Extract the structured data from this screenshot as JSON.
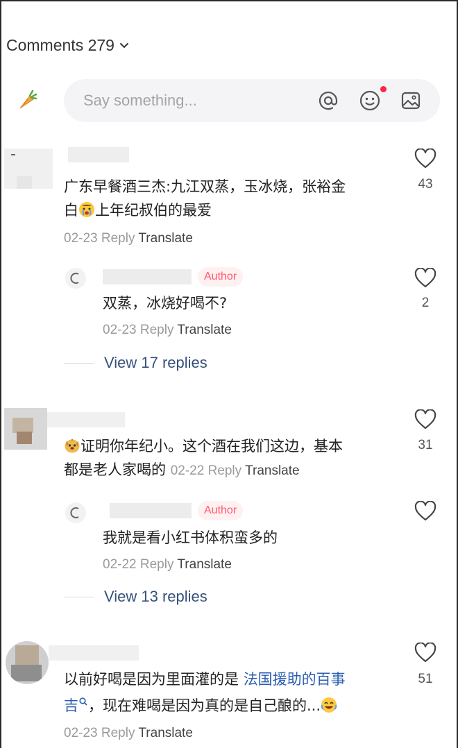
{
  "header": {
    "title": "Comments 279"
  },
  "compose": {
    "placeholder": "Say something..."
  },
  "comments": [
    {
      "text_line1": "广东早餐酒三杰:九江双蒸，玉冰烧，张裕金",
      "text_line2a": "白",
      "text_line2b": "上年纪叔伯的最爱",
      "date": "02-23",
      "reply": "Reply",
      "translate": "Translate",
      "likes": "43",
      "replies": [
        {
          "badge": "Author",
          "text": "双蒸，冰烧好喝不?",
          "date": "02-23",
          "reply": "Reply",
          "translate": "Translate",
          "likes": "2"
        }
      ],
      "view_more": "View 17 replies"
    },
    {
      "text_line1": "证明你年纪小。这个酒在我们这边，基本",
      "text_line2": "都是老人家喝的",
      "date": "02-22",
      "reply": "Reply",
      "translate": "Translate",
      "likes": "31",
      "replies": [
        {
          "badge": "Author",
          "text": "我就是看小红书体积蛮多的",
          "date": "02-22",
          "reply": "Reply",
          "translate": "Translate",
          "likes": ""
        }
      ],
      "view_more": "View 13 replies"
    },
    {
      "text_line1a": "以前好喝是因为里面灌的是 ",
      "text_line1_link": "法国援助的百事",
      "text_line2_link": "吉",
      "text_line2b": "，现在难喝是因为真的是自己酿的...",
      "date": "02-23",
      "reply": "Reply",
      "translate": "Translate",
      "likes": "51"
    }
  ],
  "colors": {
    "accent": "#ff2442",
    "author_badge_bg": "#fff0f2",
    "author_badge_text": "#ff5a6e",
    "link": "#2a5db0",
    "muted": "#9a9a9a"
  },
  "icons": [
    "chevron-down-icon",
    "carrot-avatar-icon",
    "at-icon",
    "emoji-icon",
    "image-icon",
    "heart-icon",
    "search-mini-icon",
    "crying-emoji-icon",
    "dog-emoji-icon",
    "laughing-emoji-icon"
  ]
}
